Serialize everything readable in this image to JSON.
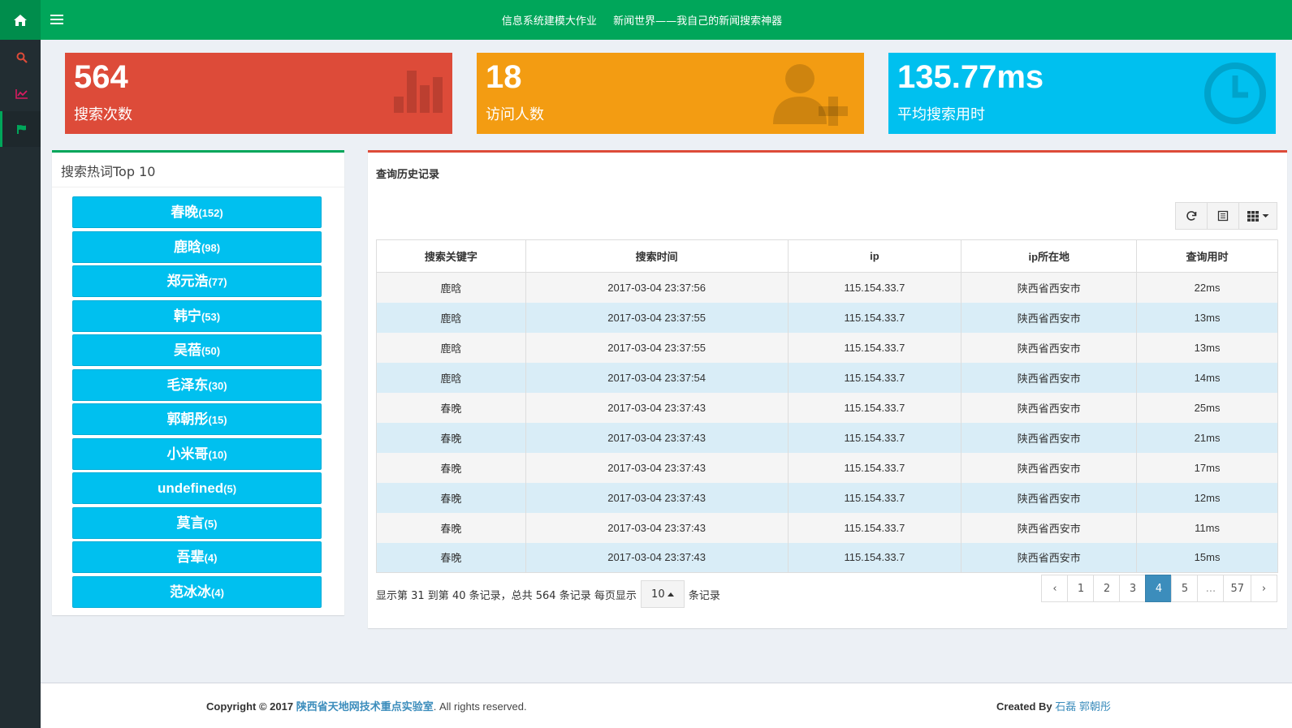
{
  "colors": {
    "green": "#00a65a",
    "red": "#dd4b39",
    "orange": "#f39c12",
    "aqua": "#00c0ef",
    "blue": "#3c8dbc"
  },
  "sidebar": {
    "items": [
      {
        "icon": "home-icon"
      },
      {
        "icon": "search-icon"
      },
      {
        "icon": "line-chart-icon"
      },
      {
        "icon": "flag-icon"
      }
    ]
  },
  "header": {
    "title_main": "信息系统建模大作业",
    "title_sub": "新闻世界——我自己的新闻搜索神器"
  },
  "stats": {
    "searches": {
      "value": "564",
      "label": "搜索次数"
    },
    "visitors": {
      "value": "18",
      "label": "访问人数"
    },
    "avg_time": {
      "value": "135.77ms",
      "label": "平均搜索用时"
    }
  },
  "hot": {
    "title": "搜索热词Top  10",
    "items": [
      {
        "word": "春晚",
        "count": "(152)"
      },
      {
        "word": "鹿晗",
        "count": "(98)"
      },
      {
        "word": "郑元浩",
        "count": "(77)"
      },
      {
        "word": "韩宁",
        "count": "(53)"
      },
      {
        "word": "吴蓓",
        "count": "(50)"
      },
      {
        "word": "毛泽东",
        "count": "(30)"
      },
      {
        "word": "郭朝彤",
        "count": "(15)"
      },
      {
        "word": "小米哥",
        "count": "(10)"
      },
      {
        "word": "undefined",
        "count": "(5)"
      },
      {
        "word": "莫言",
        "count": "(5)"
      },
      {
        "word": "吾辈",
        "count": "(4)"
      },
      {
        "word": "范冰冰",
        "count": "(4)"
      }
    ]
  },
  "history": {
    "title": "查询历史记录",
    "columns": [
      "搜索关键字",
      "搜索时间",
      "ip",
      "ip所在地",
      "查询用时"
    ],
    "rows": [
      [
        "鹿晗",
        "2017-03-04 23:37:56",
        "115.154.33.7",
        "陕西省西安市",
        "22ms"
      ],
      [
        "鹿晗",
        "2017-03-04 23:37:55",
        "115.154.33.7",
        "陕西省西安市",
        "13ms"
      ],
      [
        "鹿晗",
        "2017-03-04 23:37:55",
        "115.154.33.7",
        "陕西省西安市",
        "13ms"
      ],
      [
        "鹿晗",
        "2017-03-04 23:37:54",
        "115.154.33.7",
        "陕西省西安市",
        "14ms"
      ],
      [
        "春晚",
        "2017-03-04 23:37:43",
        "115.154.33.7",
        "陕西省西安市",
        "25ms"
      ],
      [
        "春晚",
        "2017-03-04 23:37:43",
        "115.154.33.7",
        "陕西省西安市",
        "21ms"
      ],
      [
        "春晚",
        "2017-03-04 23:37:43",
        "115.154.33.7",
        "陕西省西安市",
        "17ms"
      ],
      [
        "春晚",
        "2017-03-04 23:37:43",
        "115.154.33.7",
        "陕西省西安市",
        "12ms"
      ],
      [
        "春晚",
        "2017-03-04 23:37:43",
        "115.154.33.7",
        "陕西省西安市",
        "11ms"
      ],
      [
        "春晚",
        "2017-03-04 23:37:43",
        "115.154.33.7",
        "陕西省西安市",
        "15ms"
      ]
    ],
    "page_info_prefix": "显示第 31 到第 40 条记录，总共 564 条记录 每页显示",
    "page_size": "10",
    "page_info_suffix": "条记录",
    "pages": [
      "‹",
      "1",
      "2",
      "3",
      "4",
      "5",
      "...",
      "57",
      "›"
    ],
    "active_page": "4"
  },
  "footer": {
    "copyright": "Copyright © 2017",
    "org": "陕西省天地网技术重点实验室",
    "rights": ". All rights reserved.",
    "created_by": "Created By",
    "authors": "石磊 郭朝彤"
  }
}
